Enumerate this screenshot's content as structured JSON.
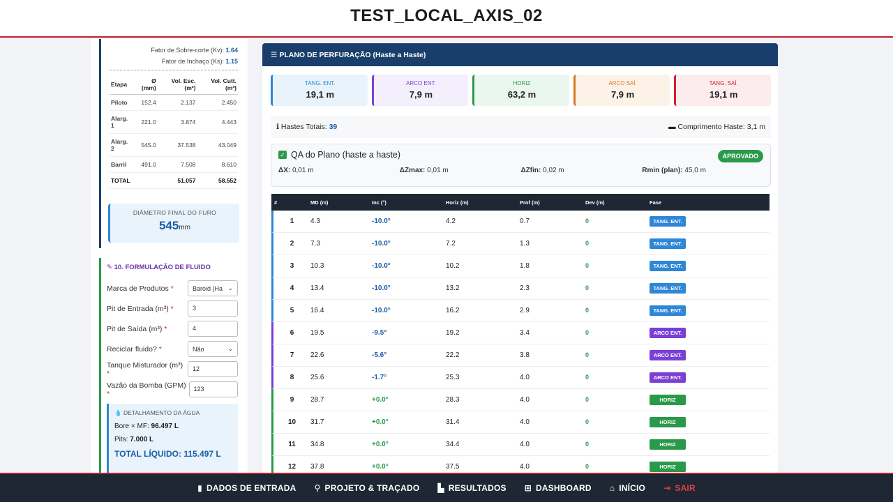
{
  "title": "TEST_LOCAL_AXIS_02",
  "left": {
    "factors": [
      {
        "label": "Fator de Sobre-corte (Kv):",
        "value": "1.64"
      },
      {
        "label": "Fator de Inchaço (Ks):",
        "value": "1.15"
      }
    ],
    "table": {
      "headers": [
        "Etapa",
        "Ø (mm)",
        "Vol. Esc. (m³)",
        "Vol. Cutt. (m³)"
      ],
      "rows": [
        [
          "Piloto",
          "152.4",
          "2.137",
          "2.450"
        ],
        [
          "Alarg. 1",
          "221.0",
          "3.874",
          "4.443"
        ],
        [
          "Alarg. 2",
          "545.0",
          "37.538",
          "43.049"
        ],
        [
          "Barril",
          "491.0",
          "7.508",
          "8.610"
        ]
      ],
      "total": [
        "TOTAL",
        "",
        "51.057",
        "58.552"
      ]
    },
    "diameter": {
      "label": "DIÂMETRO FINAL DO FURO",
      "value": "545",
      "unit": "mm"
    },
    "fluid": {
      "heading": "10. FORMULAÇÃO DE FLUIDO",
      "fields": [
        {
          "label": "Marca de Produtos",
          "value": "Baroid (Ha",
          "type": "select"
        },
        {
          "label": "Pit de Entrada (m³)",
          "value": "3",
          "type": "input"
        },
        {
          "label": "Pit de Saída (m³)",
          "value": "4",
          "type": "input"
        },
        {
          "label": "Reciclar fluido?",
          "value": "Não",
          "type": "select"
        },
        {
          "label": "Tanque Misturador (m³)",
          "value": "12",
          "type": "input"
        },
        {
          "label": "Vazão da Bomba (GPM)",
          "value": "123",
          "type": "input"
        }
      ],
      "water": {
        "title": "DETALHAMENTO DA ÁGUA",
        "bore_label": "Bore × MF:",
        "bore_value": "96.497 L",
        "pits_label": "Pits:",
        "pits_value": "7.000 L",
        "total": "TOTAL LÍQUIDO: 115.497 L"
      }
    }
  },
  "plan": {
    "heading": "PLANO DE PERFURAÇÃO (Haste a Haste)",
    "phases": [
      {
        "name": "TANG. ENT.",
        "value": "19,1 m",
        "color": "#2d86d6",
        "bg": "#e8f3fc"
      },
      {
        "name": "ARCO ENT.",
        "value": "7,9 m",
        "color": "#7b3fd6",
        "bg": "#f4effc"
      },
      {
        "name": "HORIZ",
        "value": "63,2 m",
        "color": "#2a9a4a",
        "bg": "#eaf7ee"
      },
      {
        "name": "ARCO SAÍ.",
        "value": "7,9 m",
        "color": "#d9761f",
        "bg": "#fdf2e8"
      },
      {
        "name": "TANG. SAÍ.",
        "value": "19,1 m",
        "color": "#d0202e",
        "bg": "#fdeced"
      }
    ],
    "rods_label": "Hastes Totais:",
    "rods_value": "39",
    "rod_length": "Comprimento Haste: 3,1 m",
    "qa": {
      "title": "QA do Plano (haste a haste)",
      "status": "APROVADO",
      "metrics": [
        {
          "label": "ΔX:",
          "value": "0,01 m"
        },
        {
          "label": "ΔZmax:",
          "value": "0,01 m"
        },
        {
          "label": "ΔZfin:",
          "value": "0,02 m"
        },
        {
          "label": "Rmin (plan):",
          "value": "45,0 m"
        }
      ]
    },
    "columns": [
      "#",
      "MD (m)",
      "Inc (°)",
      "Horiz (m)",
      "Prof (m)",
      "Dev (m)",
      "Fase"
    ],
    "rows": [
      [
        "1",
        "4.3",
        "-10.0°",
        "4.2",
        "0.7",
        "0",
        "TANG. ENT."
      ],
      [
        "2",
        "7.3",
        "-10.0°",
        "7.2",
        "1.3",
        "0",
        "TANG. ENT."
      ],
      [
        "3",
        "10.3",
        "-10.0°",
        "10.2",
        "1.8",
        "0",
        "TANG. ENT."
      ],
      [
        "4",
        "13.4",
        "-10.0°",
        "13.2",
        "2.3",
        "0",
        "TANG. ENT."
      ],
      [
        "5",
        "16.4",
        "-10.0°",
        "16.2",
        "2.9",
        "0",
        "TANG. ENT."
      ],
      [
        "6",
        "19.5",
        "-9.5°",
        "19.2",
        "3.4",
        "0",
        "ARCO ENT."
      ],
      [
        "7",
        "22.6",
        "-5.6°",
        "22.2",
        "3.8",
        "0",
        "ARCO ENT."
      ],
      [
        "8",
        "25.6",
        "-1.7°",
        "25.3",
        "4.0",
        "0",
        "ARCO ENT."
      ],
      [
        "9",
        "28.7",
        "+0.0°",
        "28.3",
        "4.0",
        "0",
        "HORIZ"
      ],
      [
        "10",
        "31.7",
        "+0.0°",
        "31.4",
        "4.0",
        "0",
        "HORIZ"
      ],
      [
        "11",
        "34.8",
        "+0.0°",
        "34.4",
        "4.0",
        "0",
        "HORIZ"
      ],
      [
        "12",
        "37.8",
        "+0.0°",
        "37.5",
        "4.0",
        "0",
        "HORIZ"
      ]
    ]
  },
  "nav": [
    {
      "label": "DADOS DE ENTRADA",
      "icon": "file-icon"
    },
    {
      "label": "PROJETO & TRAÇADO",
      "icon": "compass-icon"
    },
    {
      "label": "RESULTADOS",
      "icon": "chart-icon"
    },
    {
      "label": "DASHBOARD",
      "icon": "grid-icon"
    },
    {
      "label": "INÍCIO",
      "icon": "home-icon"
    },
    {
      "label": "SAIR",
      "icon": "exit-icon"
    }
  ]
}
